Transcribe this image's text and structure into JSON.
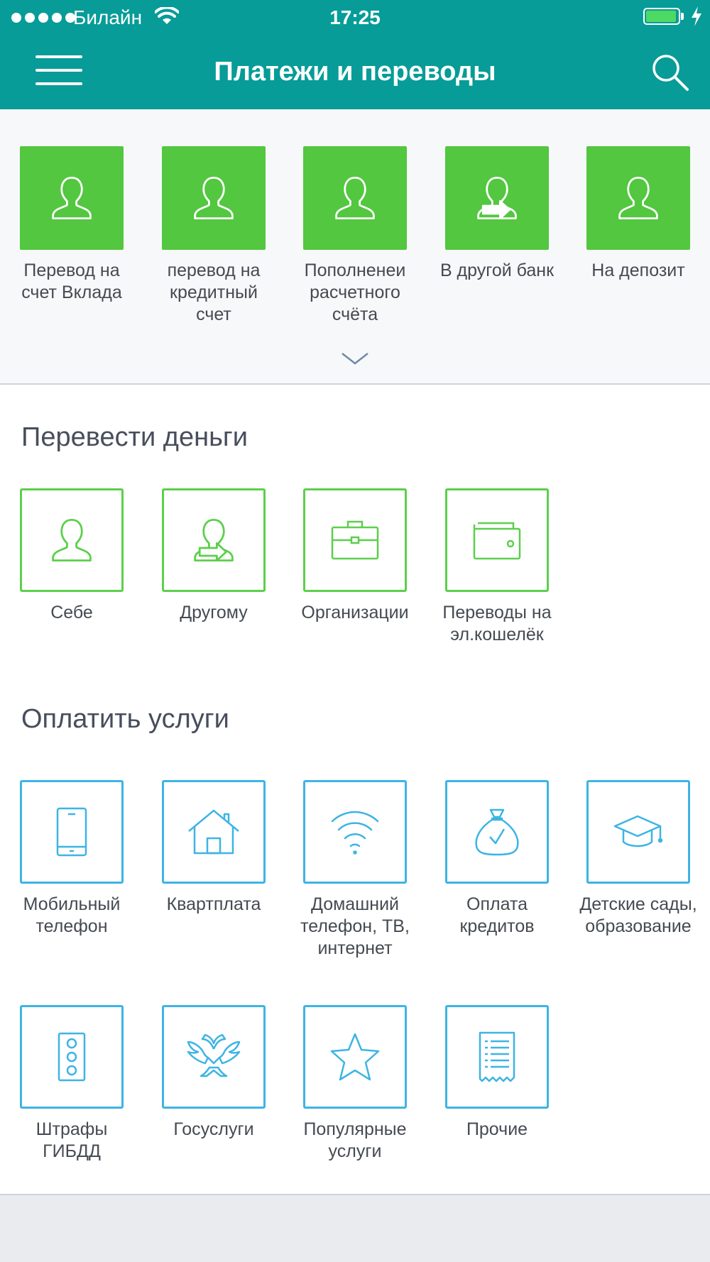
{
  "status_bar": {
    "carrier": "Билайн",
    "time": "17:25",
    "battery_level": 0.95
  },
  "nav": {
    "title": "Платежи и переводы"
  },
  "quick_actions": [
    {
      "label": "Перевод на счет Вклада",
      "icon": "person-icon"
    },
    {
      "label": "перевод на кредитный счет",
      "icon": "person-icon"
    },
    {
      "label": "Пополненеи расчетного счёта",
      "icon": "person-icon"
    },
    {
      "label": "В другой банк",
      "icon": "person-transfer-icon"
    },
    {
      "label": "На депозит",
      "icon": "person-icon"
    }
  ],
  "transfer_section": {
    "title": "Перевести деньги",
    "items": [
      {
        "label": "Себе",
        "icon": "person-icon"
      },
      {
        "label": "Другому",
        "icon": "person-transfer-icon"
      },
      {
        "label": "Организации",
        "icon": "briefcase-icon"
      },
      {
        "label": "Переводы на эл.кошелёк",
        "icon": "wallet-icon"
      }
    ]
  },
  "services_section": {
    "title": "Оплатить услуги",
    "items": [
      {
        "label": "Мобильный телефон",
        "icon": "mobile-phone-icon"
      },
      {
        "label": "Квартплата",
        "icon": "house-icon"
      },
      {
        "label": "Домашний телефон, ТВ, интернет",
        "icon": "wifi-icon"
      },
      {
        "label": "Оплата кредитов",
        "icon": "money-bag-icon"
      },
      {
        "label": "Детские сады, образование",
        "icon": "graduation-cap-icon"
      },
      {
        "label": "Штрафы ГИБДД",
        "icon": "traffic-light-icon"
      },
      {
        "label": "Госуслуги",
        "icon": "coat-of-arms-icon"
      },
      {
        "label": "Популярные услуги",
        "icon": "star-icon"
      },
      {
        "label": "Прочие",
        "icon": "receipt-icon"
      }
    ]
  },
  "colors": {
    "header": "#079c98",
    "green": "#52c73f",
    "green_outline": "#5ccf4c",
    "blue_outline": "#3db4e4",
    "text": "#454a52"
  }
}
